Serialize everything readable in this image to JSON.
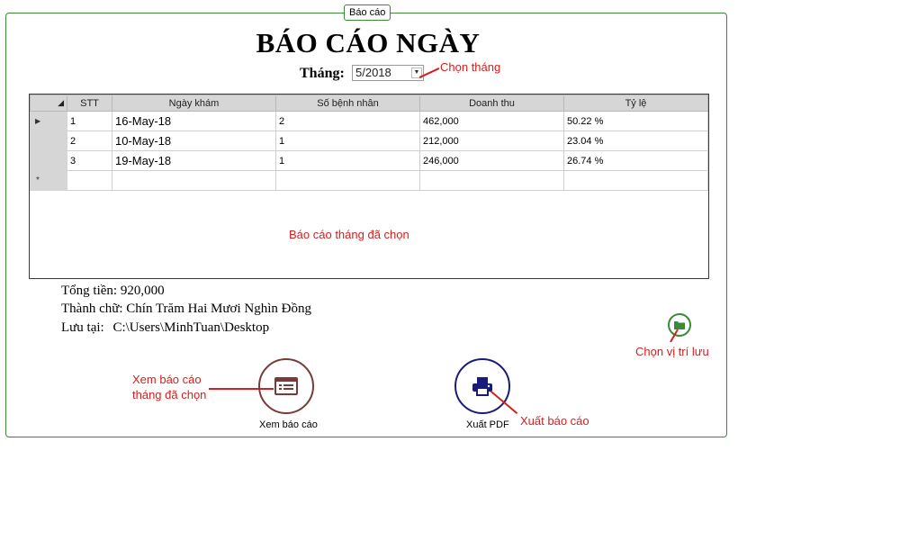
{
  "group": {
    "title": "Báo cáo"
  },
  "report": {
    "title": "BÁO CÁO NGÀY"
  },
  "month": {
    "label": "Tháng:",
    "value": "5/2018",
    "dropdown_icon": "chevron-down-icon"
  },
  "annotations": {
    "choose_month": "Chọn tháng",
    "report_selected": "Báo cáo tháng đã chọn",
    "choose_location": "Chọn vị trí lưu",
    "view_report_line1": "Xem báo cáo",
    "view_report_line2": "tháng đã chọn",
    "export_report": "Xuất báo cáo"
  },
  "grid": {
    "columns": [
      "STT",
      "Ngày khám",
      "Số bệnh nhân",
      "Doanh  thu",
      "Tỷ lệ"
    ],
    "rows": [
      {
        "stt": "1",
        "date": "16-May-18",
        "patients": "2",
        "revenue": "462,000",
        "ratio": "50.22 %"
      },
      {
        "stt": "2",
        "date": "10-May-18",
        "patients": "1",
        "revenue": "212,000",
        "ratio": "23.04 %"
      },
      {
        "stt": "3",
        "date": "19-May-18",
        "patients": "1",
        "revenue": "246,000",
        "ratio": "26.74 %"
      }
    ]
  },
  "summary": {
    "total": "Tổng tiền: 920,000",
    "in_words": "Thành chữ: Chín Trăm Hai Mươi Nghìn Đồng",
    "save_label": "Lưu tại:",
    "save_path": "C:\\Users\\MinhTuan\\Desktop"
  },
  "buttons": {
    "view": {
      "label": "Xem báo cáo",
      "icon": "report-icon"
    },
    "export": {
      "label": "Xuất PDF",
      "icon": "printer-icon"
    },
    "folder": {
      "icon": "folder-icon"
    }
  },
  "colors": {
    "frame": "#3a8a3a",
    "annotation": "#d42020",
    "view_ring": "#7a3a3a",
    "export_ring": "#1a1a7a"
  }
}
